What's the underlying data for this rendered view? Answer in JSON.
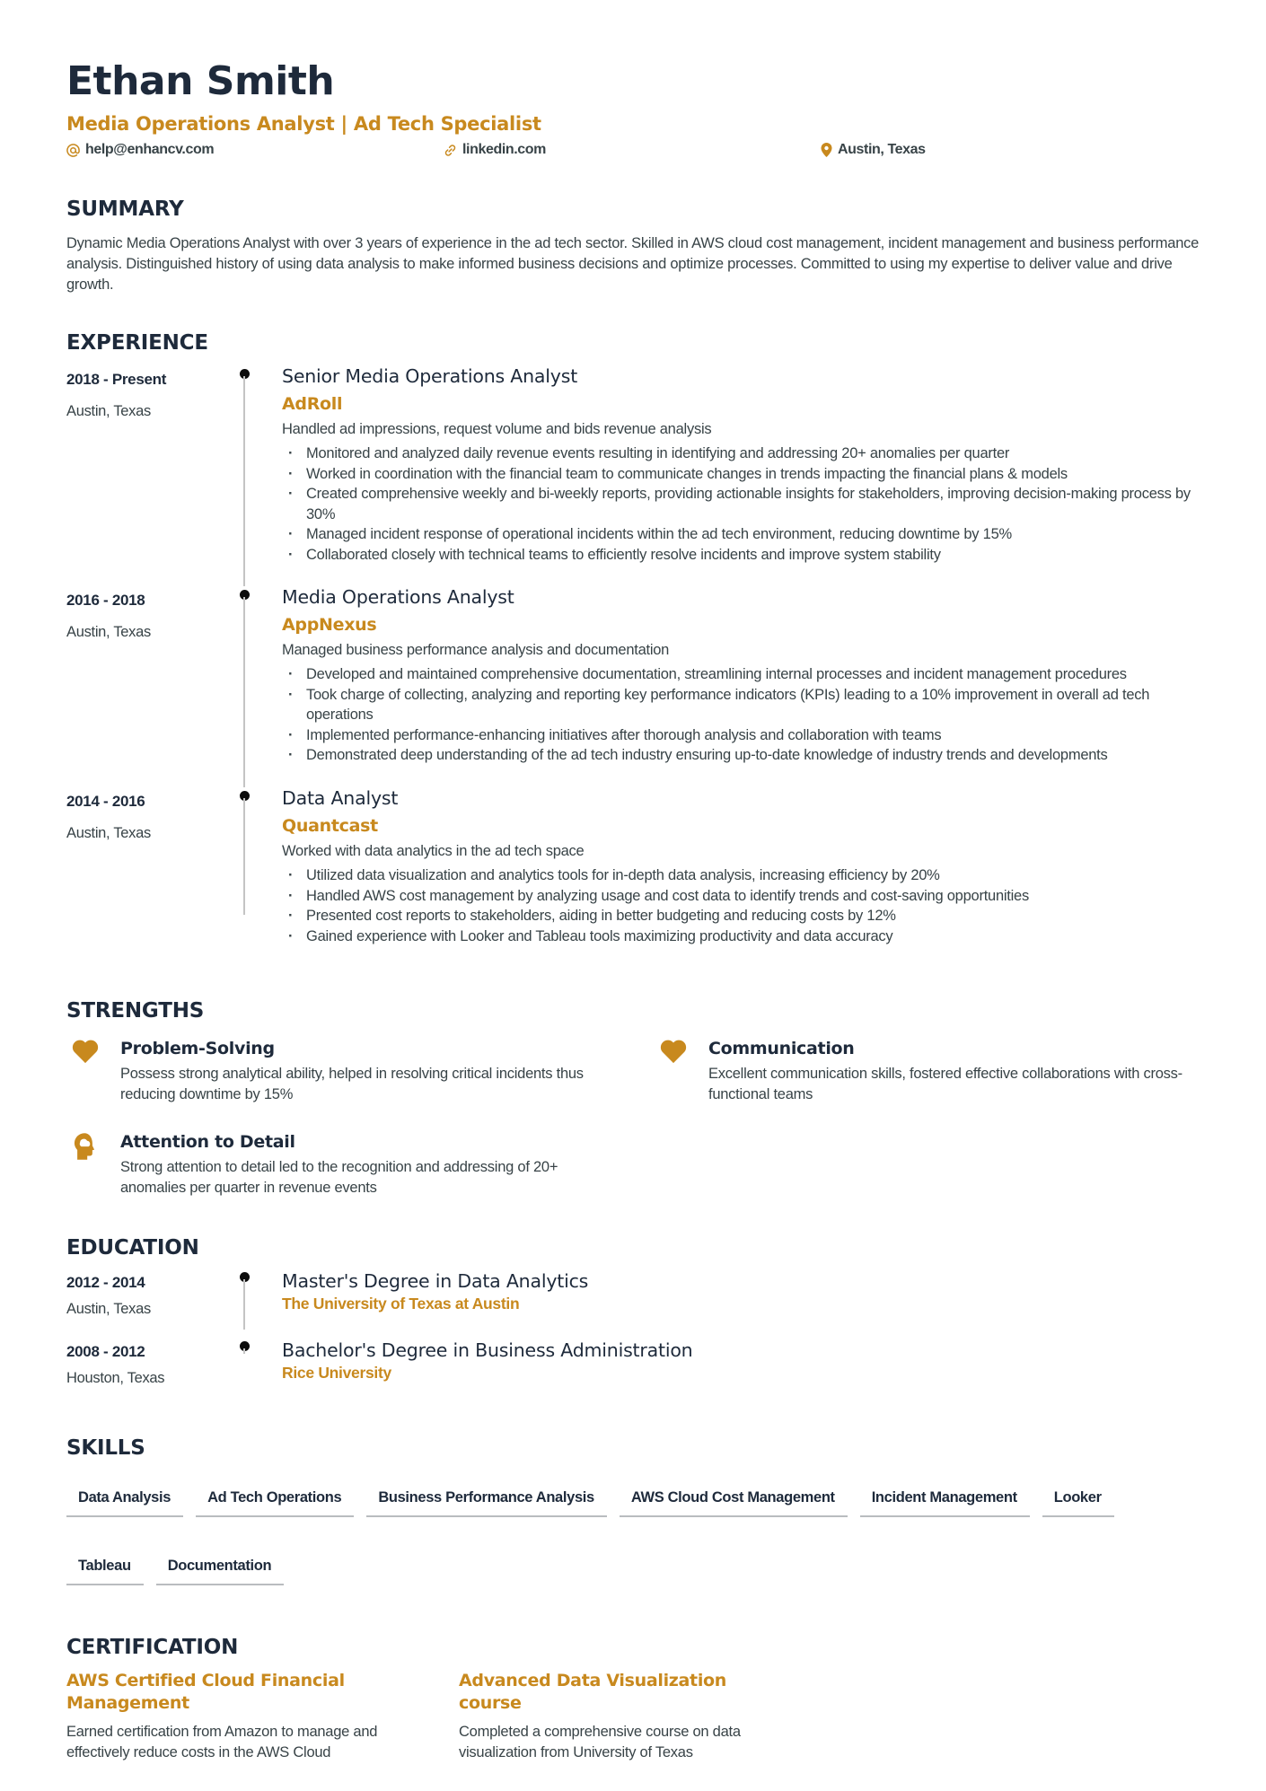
{
  "header": {
    "name": "Ethan Smith",
    "headline": "Media Operations Analyst | Ad Tech Specialist",
    "contacts": [
      {
        "icon": "at-icon",
        "text": "help@enhancv.com"
      },
      {
        "icon": "link-icon",
        "text": "linkedin.com"
      },
      {
        "icon": "location-pin-icon",
        "text": "Austin, Texas"
      }
    ]
  },
  "colors": {
    "accent": "#c8891e",
    "heading": "#1e2a3b",
    "body": "#384347",
    "timeline_dot": "#0c0c0c",
    "timeline_line": "#c4c4c4",
    "skill_underline": "#b9bcbf"
  },
  "summary": {
    "title": "SUMMARY",
    "text": "Dynamic Media Operations Analyst with over 3 years of experience in the ad tech sector. Skilled in AWS cloud cost management, incident management and business performance analysis. Distinguished history of using data analysis to make informed business decisions and optimize processes. Committed to using my expertise to deliver value and drive growth."
  },
  "experience": {
    "title": "EXPERIENCE",
    "items": [
      {
        "dates": "2018 - Present",
        "location": "Austin, Texas",
        "role": "Senior Media Operations Analyst",
        "company": "AdRoll",
        "description": "Handled ad impressions, request volume and bids revenue analysis",
        "bullets": [
          "Monitored and analyzed daily revenue events resulting in identifying and addressing 20+ anomalies per quarter",
          "Worked in coordination with the financial team to communicate changes in trends impacting the financial plans & models",
          "Created comprehensive weekly and bi-weekly reports, providing actionable insights for stakeholders, improving decision-making process by 30%",
          "Managed incident response of operational incidents within the ad tech environment, reducing downtime by 15%",
          "Collaborated closely with technical teams to efficiently resolve incidents and improve system stability"
        ]
      },
      {
        "dates": "2016 - 2018",
        "location": "Austin, Texas",
        "role": "Media Operations Analyst",
        "company": "AppNexus",
        "description": "Managed business performance analysis and documentation",
        "bullets": [
          "Developed and maintained comprehensive documentation, streamlining internal processes and incident management procedures",
          "Took charge of collecting, analyzing and reporting key performance indicators (KPIs) leading to a 10% improvement in overall ad tech operations",
          "Implemented performance-enhancing initiatives after thorough analysis and collaboration with teams",
          "Demonstrated deep understanding of the ad tech industry ensuring up-to-date knowledge of industry trends and developments"
        ]
      },
      {
        "dates": "2014 - 2016",
        "location": "Austin, Texas",
        "role": "Data Analyst",
        "company": "Quantcast",
        "description": "Worked with data analytics in the ad tech space",
        "bullets": [
          "Utilized data visualization and analytics tools for in-depth data analysis, increasing efficiency by 20%",
          "Handled AWS cost management by analyzing usage and cost data to identify trends and cost-saving opportunities",
          "Presented cost reports to stakeholders, aiding in better budgeting and reducing costs by 12%",
          "Gained experience with Looker and Tableau tools maximizing productivity and data accuracy"
        ]
      }
    ]
  },
  "strengths": {
    "title": "STRENGTHS",
    "items": [
      {
        "icon": "heart-icon",
        "title": "Problem-Solving",
        "description": "Possess strong analytical ability, helped in resolving critical incidents thus reducing downtime by 15%"
      },
      {
        "icon": "heart-icon",
        "title": "Communication",
        "description": "Excellent communication skills, fostered effective collaborations with cross-functional teams"
      },
      {
        "icon": "head-brain-icon",
        "title": "Attention to Detail",
        "description": "Strong attention to detail led to the recognition and addressing of 20+ anomalies per quarter in revenue events"
      }
    ]
  },
  "education": {
    "title": "EDUCATION",
    "items": [
      {
        "dates": "2012 - 2014",
        "location": "Austin, Texas",
        "degree": "Master's Degree in Data Analytics",
        "school": "The University of Texas at Austin"
      },
      {
        "dates": "2008 - 2012",
        "location": "Houston, Texas",
        "degree": "Bachelor's Degree in Business Administration",
        "school": "Rice University"
      }
    ]
  },
  "skills": {
    "title": "SKILLS",
    "items": [
      "Data Analysis",
      "Ad Tech Operations",
      "Business Performance Analysis",
      "AWS Cloud Cost Management",
      "Incident Management",
      "Looker",
      "Tableau",
      "Documentation"
    ]
  },
  "certification": {
    "title": "CERTIFICATION",
    "items": [
      {
        "title": "AWS Certified Cloud Financial Management",
        "description": "Earned certification from Amazon to manage and effectively reduce costs in the AWS Cloud"
      },
      {
        "title": "Advanced Data Visualization course",
        "description": "Completed a comprehensive course on data visualization from University of Texas"
      }
    ]
  }
}
